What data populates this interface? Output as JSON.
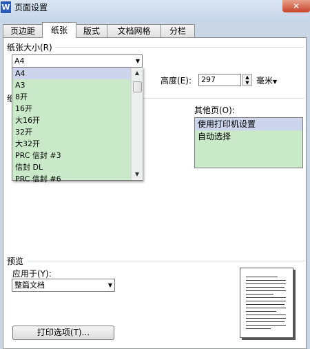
{
  "window": {
    "title": "页面设置",
    "app_icon": "W",
    "close_glyph": "✕"
  },
  "tabs": [
    {
      "label": "页边距"
    },
    {
      "label": "纸张"
    },
    {
      "label": "版式"
    },
    {
      "label": "文档网格"
    },
    {
      "label": "分栏"
    }
  ],
  "paper_size": {
    "group_label": "纸张大小(R)",
    "selected": "A4",
    "options": [
      "A4",
      "A3",
      "8开",
      "16开",
      "大16开",
      "32开",
      "大32开",
      "PRC 信封 #3",
      "信封 DL",
      "PRC 信封 #6"
    ],
    "height_label": "高度(E):",
    "height_value": "297",
    "unit": "毫米"
  },
  "paper_source": {
    "group_label_partial": "纸",
    "other_pages_label": "其他页(O):",
    "other_pages_options": [
      "使用打印机设置",
      "自动选择"
    ]
  },
  "preview": {
    "group_label": "预览",
    "apply_label": "应用于(Y):",
    "apply_value": "整篇文档"
  },
  "buttons": {
    "print_options": "打印选项(T)..."
  },
  "icons": {
    "dropdown": "chevron-down-icon",
    "scroll_up": "arrow-up-icon",
    "scroll_down": "arrow-down-icon"
  }
}
